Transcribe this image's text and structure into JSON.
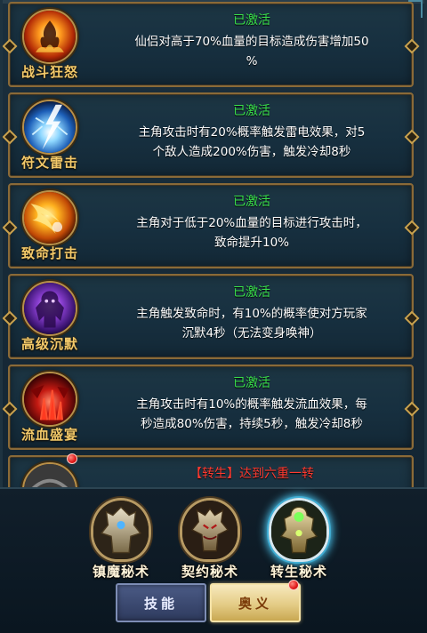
{
  "skills": [
    {
      "name": "战斗狂怒",
      "status": "已激活",
      "desc_line1": "仙侣对高于70%血量的目标造成伤害增加50",
      "desc_line2": "%",
      "icon": "battle-rage-icon"
    },
    {
      "name": "符文雷击",
      "status": "已激活",
      "desc_line1": "主角攻击时有20%概率触发雷电效果，对5",
      "desc_line2": "个敌人造成200%伤害，触发冷却8秒",
      "icon": "rune-thunder-icon"
    },
    {
      "name": "致命打击",
      "status": "已激活",
      "desc_line1": "主角对于低于20%血量的目标进行攻击时，",
      "desc_line2": "致命提升10%",
      "icon": "fatal-strike-icon"
    },
    {
      "name": "高级沉默",
      "status": "已激活",
      "desc_line1": "主角触发致命时，有10%的概率使对方玩家",
      "desc_line2": "沉默4秒（无法变身唤神）",
      "icon": "advanced-silence-icon"
    },
    {
      "name": "流血盛宴",
      "status": "已激活",
      "desc_line1": "主角攻击时有10%的概率触发流血效果，每",
      "desc_line2": "秒造成80%伤害，持续5秒，触发冷却8秒",
      "icon": "bleeding-feast-icon"
    }
  ],
  "locked_skill": {
    "status": "【转生】达到六重一转"
  },
  "tabs": [
    {
      "label": "镇魔秘术",
      "icon": "demon-suppress-icon"
    },
    {
      "label": "契约秘术",
      "icon": "contract-icon"
    },
    {
      "label": "转生秘术",
      "icon": "rebirth-icon"
    }
  ],
  "buttons": {
    "skill": "技能",
    "secret": "奥义"
  },
  "colors": {
    "status_active": "#39e04a",
    "status_locked": "#ff3a30",
    "skill_name": "#f2c96a"
  }
}
